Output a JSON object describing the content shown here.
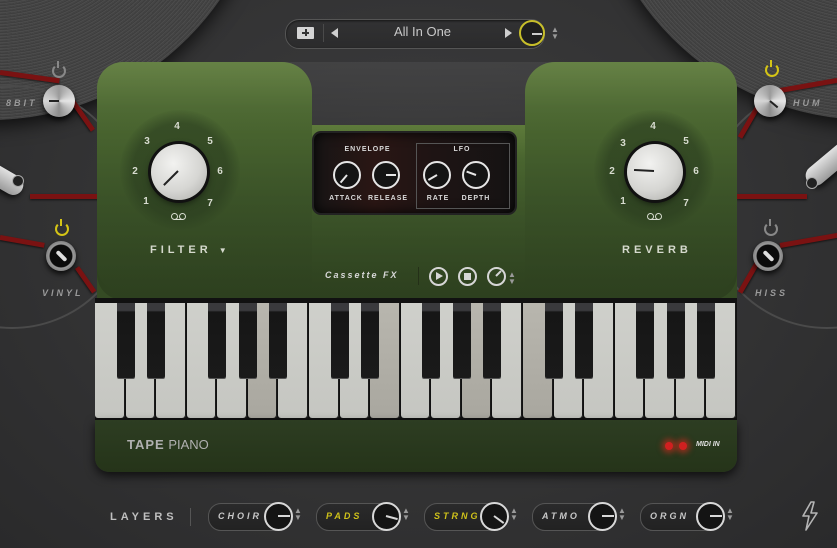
{
  "app": {
    "title": "Tape Piano"
  },
  "preset_bar": {
    "folder_icon": "folder-add-icon",
    "prev_icon": "triangle-left-icon",
    "next_icon": "triangle-right-icon",
    "preset_name": "All In One",
    "volume_icon": "knob-icon",
    "updown_icon": "up-down-arrows-icon"
  },
  "filter": {
    "label": "FILTER",
    "dropdown_icon": "triangle-down-icon",
    "scale": [
      "1",
      "2",
      "3",
      "4",
      "5",
      "6",
      "7"
    ],
    "value_scale_position": 1.3,
    "icon": "cassette-tape-icon"
  },
  "reverb": {
    "label": "REVERB",
    "scale": [
      "1",
      "2",
      "3",
      "4",
      "5",
      "6",
      "7"
    ],
    "value_scale_position": 2.0,
    "icon": "cassette-tape-icon"
  },
  "screen": {
    "envelope": {
      "title": "ENVELOPE",
      "knobs": [
        {
          "label": "ATTACK",
          "value": 0.15
        },
        {
          "label": "RELEASE",
          "value": 0.5
        }
      ]
    },
    "lfo": {
      "title": "LFO",
      "knobs": [
        {
          "label": "RATE",
          "value": 0.2
        },
        {
          "label": "DEPTH",
          "value": 0.35
        }
      ]
    }
  },
  "cassette_fx": {
    "label": "Cassette FX",
    "play_icon": "play-icon",
    "stop_icon": "stop-icon",
    "knob_icon": "knob-icon",
    "updown_icon": "up-down-arrows-icon"
  },
  "side_fx": [
    {
      "label": "8BIT",
      "power": false,
      "type": "knob"
    },
    {
      "label": "VINYL",
      "power": true,
      "type": "switch"
    },
    {
      "label": "HUM",
      "power": true,
      "type": "knob"
    },
    {
      "label": "HISS",
      "power": false,
      "type": "switch"
    }
  ],
  "keyboard": {
    "octaves": 3,
    "white_keys": 21,
    "pressed_white_keys": [
      5,
      9,
      12,
      14
    ]
  },
  "brand": {
    "bold": "TAPE",
    "light": "PIANO"
  },
  "midi": {
    "label": "MIDI IN",
    "led_color": "#d02020"
  },
  "layers": {
    "label": "LAYERS",
    "items": [
      {
        "name": "CHOIR",
        "active": false,
        "value": 0.5
      },
      {
        "name": "PADS",
        "active": true,
        "value": 0.55
      },
      {
        "name": "STRNG",
        "active": true,
        "value": 0.62
      },
      {
        "name": "ATMO",
        "active": false,
        "value": 0.5
      },
      {
        "name": "ORGN",
        "active": false,
        "value": 0.5
      }
    ]
  },
  "footer": {
    "bolt_icon": "lightning-bolt-icon"
  },
  "colors": {
    "accent_yellow": "#d4c416",
    "body_green": "#4b6730",
    "background": "#333334",
    "wire_red": "#7a1212"
  }
}
